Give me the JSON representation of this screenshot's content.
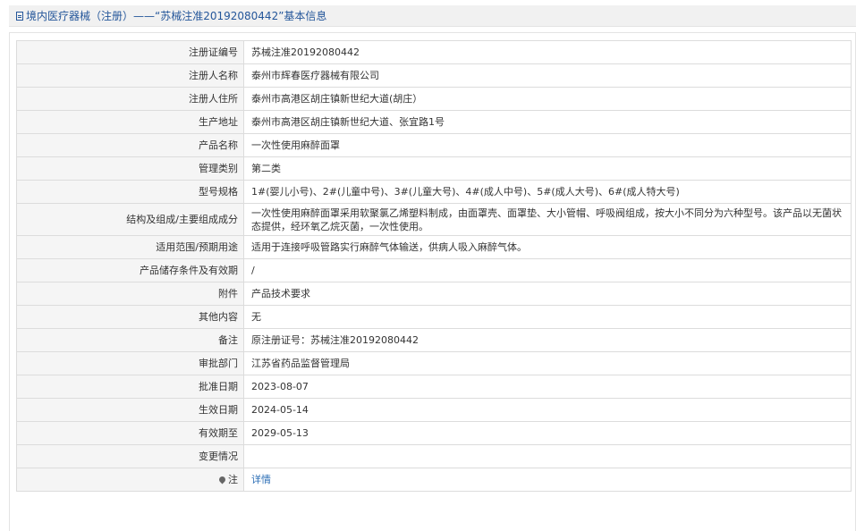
{
  "header": {
    "title": "境内医疗器械（注册）——“苏械注准20192080442”基本信息"
  },
  "rows": [
    {
      "label": "注册证编号",
      "value": "苏械注准20192080442"
    },
    {
      "label": "注册人名称",
      "value": "泰州市辉春医疗器械有限公司"
    },
    {
      "label": "注册人住所",
      "value": "泰州市高港区胡庄镇新世纪大道(胡庄）"
    },
    {
      "label": "生产地址",
      "value": "泰州市高港区胡庄镇新世纪大道、张宜路1号"
    },
    {
      "label": "产品名称",
      "value": "一次性使用麻醉面罩"
    },
    {
      "label": "管理类别",
      "value": "第二类"
    },
    {
      "label": "型号规格",
      "value": "1#(婴儿小号)、2#(儿童中号)、3#(儿童大号)、4#(成人中号)、5#(成人大号)、6#(成人特大号)"
    },
    {
      "label": "结构及组成/主要组成成分",
      "value": "一次性使用麻醉面罩采用软聚氯乙烯塑料制成，由面罩壳、面罩垫、大小管帽、呼吸阀组成，按大小不同分为六种型号。该产品以无菌状态提供，经环氧乙烷灭菌，一次性使用。"
    },
    {
      "label": "适用范围/预期用途",
      "value": "适用于连接呼吸管路实行麻醉气体输送，供病人吸入麻醉气体。"
    },
    {
      "label": "产品储存条件及有效期",
      "value": "/"
    },
    {
      "label": "附件",
      "value": "产品技术要求"
    },
    {
      "label": "其他内容",
      "value": "无"
    },
    {
      "label": "备注",
      "value": "原注册证号：苏械注准20192080442"
    },
    {
      "label": "审批部门",
      "value": "江苏省药品监督管理局"
    },
    {
      "label": "批准日期",
      "value": "2023-08-07"
    },
    {
      "label": "生效日期",
      "value": "2024-05-14"
    },
    {
      "label": "有效期至",
      "value": "2029-05-13"
    },
    {
      "label": "变更情况",
      "value": ""
    }
  ],
  "note": {
    "label": "注",
    "link": "详情"
  }
}
